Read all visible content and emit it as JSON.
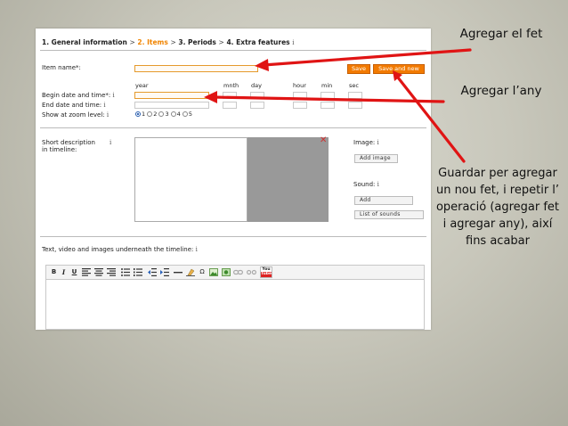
{
  "wizard": {
    "step1": "1. General information",
    "sep1": ">",
    "step2": "2. Items",
    "sep2": ">",
    "step3": "3. Periods",
    "sep3": ">",
    "step4": "4. Extra features",
    "info": "i"
  },
  "form": {
    "item_name_label": "Item name*:",
    "save_label": "Save",
    "save_new_label": "Save and new",
    "columns": {
      "year": "year",
      "month": "mnth",
      "day": "day",
      "hour": "hour",
      "min": "min",
      "sec": "sec"
    },
    "begin_label": "Begin date and time*:",
    "begin_info": "i",
    "end_label": "End date and time:",
    "end_info": "i",
    "zoom_label": "Show at zoom level:",
    "zoom_info": "i",
    "zoom_options": [
      "1",
      "2",
      "3",
      "4",
      "5"
    ],
    "zoom_selected": "1",
    "desc_label_1": "Short description",
    "desc_label_2": "in timeline:",
    "desc_info": "i",
    "close_glyph": "✕",
    "image_label": "Image:",
    "image_info": "i",
    "add_image": "Add image",
    "sound_label": "Sound:",
    "sound_info": "i",
    "add_sound": "Add",
    "list_sounds": "List of sounds",
    "text_label": "Text, video and images underneath the timeline:",
    "text_info": "i"
  },
  "toolbar": {
    "bold": "B",
    "italic": "I",
    "underline": "U",
    "omega": "Ω",
    "youtube_top": "You",
    "youtube_bottom": "Tube"
  },
  "callouts": {
    "add_item": "Agregar el fet",
    "add_year": "Agregar l’any",
    "save_line1": "Guardar per agregar",
    "save_line2": "un nou fet, i repetir l’",
    "save_line3": "operació (agregar fet",
    "save_line4": "i agregar any), així",
    "save_line5": "fins acabar"
  },
  "colors": {
    "accent_orange": "#f27a00",
    "arrow_red": "#e01414",
    "focus_border": "#e59a2c"
  }
}
